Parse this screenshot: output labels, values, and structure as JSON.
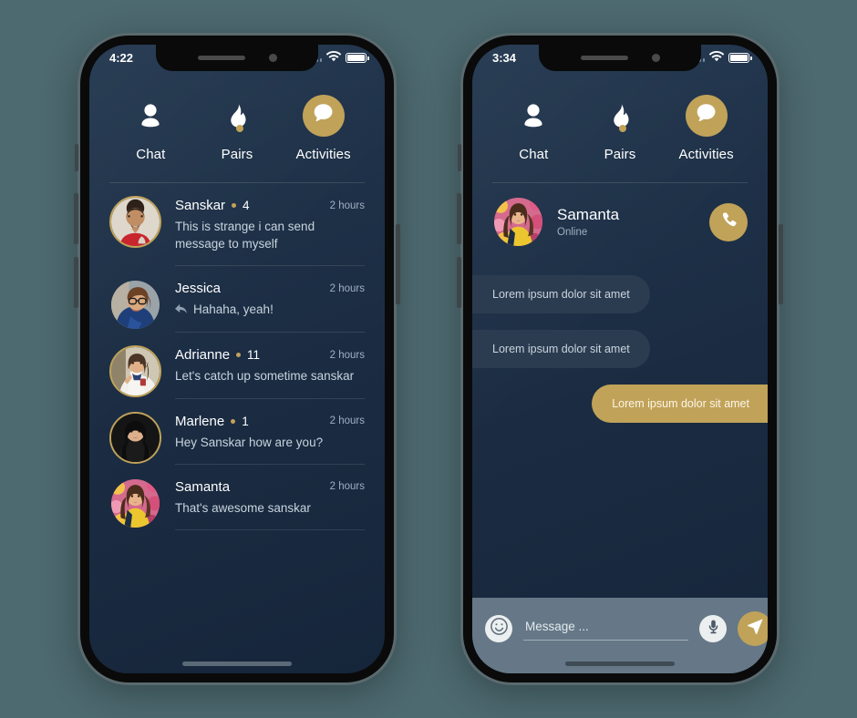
{
  "theme": {
    "page_background": "#4d6a70",
    "screen_background": "#1d3048",
    "accent_gold": "#c0a259",
    "bubble_in": "#2c3c50",
    "input_bar": "#667887",
    "text_primary": "#ffffff",
    "text_secondary": "#9fb0c2"
  },
  "phone_left": {
    "status": {
      "time": "4:22",
      "wifi_icon": "wifi-icon",
      "battery_icon": "battery-icon",
      "signal_icon": "signal-dots-icon"
    },
    "nav": {
      "items": [
        {
          "label": "Chat",
          "icon": "person-icon",
          "active": false
        },
        {
          "label": "Pairs",
          "icon": "flame-icon",
          "active": false,
          "badge_dot": true
        },
        {
          "label": "Activities",
          "icon": "chat-bubble-icon",
          "active": true
        }
      ]
    },
    "chats": [
      {
        "name": "Sanskar",
        "unread": "4",
        "time": "2 hours",
        "message": "This is strange i can send message to myself",
        "avatar": "avatar-sanskar",
        "replied": false
      },
      {
        "name": "Jessica",
        "unread": "",
        "time": "2 hours",
        "message": "Hahaha, yeah!",
        "avatar": "avatar-jessica",
        "replied": true
      },
      {
        "name": "Adrianne",
        "unread": "11",
        "time": "2 hours",
        "message": "Let's catch up sometime sanskar",
        "avatar": "avatar-adrianne",
        "replied": false
      },
      {
        "name": "Marlene",
        "unread": "1",
        "time": "2 hours",
        "message": "Hey Sanskar how are you?",
        "avatar": "avatar-marlene",
        "replied": false
      },
      {
        "name": "Samanta",
        "unread": "",
        "time": "2 hours",
        "message": "That's awesome sanskar",
        "avatar": "avatar-samanta",
        "replied": false
      }
    ]
  },
  "phone_right": {
    "status": {
      "time": "3:34",
      "wifi_icon": "wifi-icon",
      "battery_icon": "battery-icon",
      "signal_icon": "signal-dots-icon"
    },
    "nav": {
      "items": [
        {
          "label": "Chat",
          "icon": "person-icon",
          "active": false
        },
        {
          "label": "Pairs",
          "icon": "flame-icon",
          "active": false,
          "badge_dot": true
        },
        {
          "label": "Activities",
          "icon": "chat-bubble-icon",
          "active": true
        }
      ]
    },
    "conversation": {
      "contact_name": "Samanta",
      "contact_status": "Online",
      "avatar": "avatar-samanta",
      "call_button_icon": "phone-icon",
      "messages": [
        {
          "text": "Lorem ipsum dolor sit amet",
          "direction": "in"
        },
        {
          "text": "Lorem ipsum dolor sit amet",
          "direction": "in"
        },
        {
          "text": "Lorem ipsum dolor sit amet",
          "direction": "out"
        }
      ]
    },
    "composer": {
      "emoji_icon": "smiley-icon",
      "placeholder": "Message ...",
      "value": "",
      "mic_icon": "microphone-icon",
      "send_icon": "send-paper-plane-icon"
    }
  }
}
